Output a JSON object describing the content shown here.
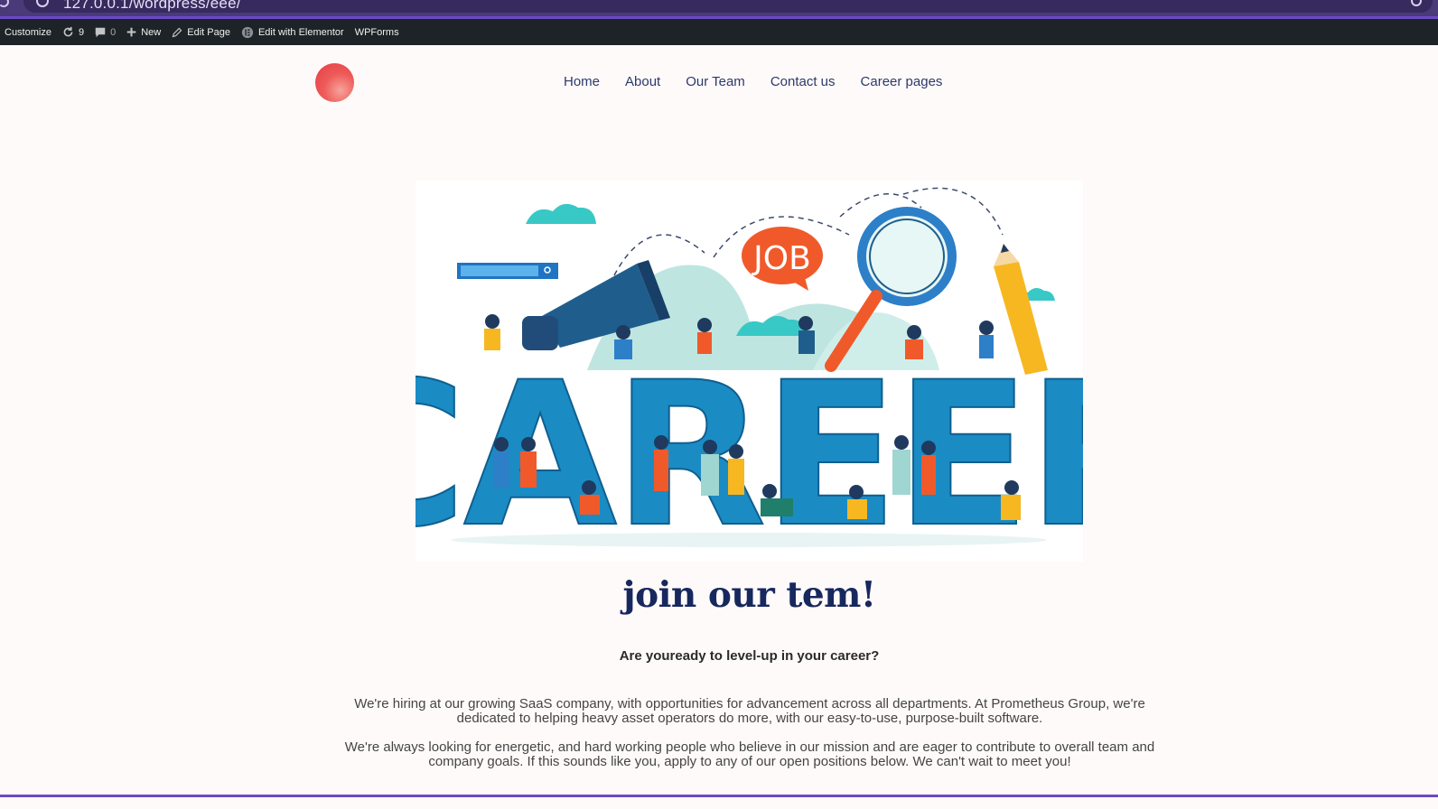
{
  "browser": {
    "url": "127.0.0.1/wordpress/eee/"
  },
  "admin_bar": {
    "customize": "Customize",
    "updates": "9",
    "comments": "0",
    "new": "New",
    "edit_page": "Edit Page",
    "elementor": "Edit with Elementor",
    "wpforms": "WPForms"
  },
  "nav": {
    "items": [
      {
        "label": "Home"
      },
      {
        "label": "About"
      },
      {
        "label": "Our Team"
      },
      {
        "label": "Contact us"
      },
      {
        "label": "Career pages"
      }
    ]
  },
  "hero": {
    "word": "CAREER",
    "bubble_text": "JOB"
  },
  "content": {
    "headline": "join our tem!",
    "subheadline": "Are youready to level-up in your career?",
    "paragraph1": "We're hiring at our growing SaaS company, with opportunities for advancement across all departments. At Prometheus Group, we're dedicated to helping heavy asset operators do more, with our easy-to-use, purpose-built software.",
    "paragraph2": "We're always looking for energetic, and hard working people who believe in our mission and are eager to contribute to overall team and company goals. If this sounds like you, apply to any of our open positions below. We can't wait to meet you!"
  },
  "colors": {
    "admin_bar": "#1d2327",
    "browser_frame": "#4a3a78",
    "accent": "#6b49c8",
    "headline": "#17285e",
    "nav_text": "#2a3a6b",
    "logo": "#ee5b59"
  }
}
